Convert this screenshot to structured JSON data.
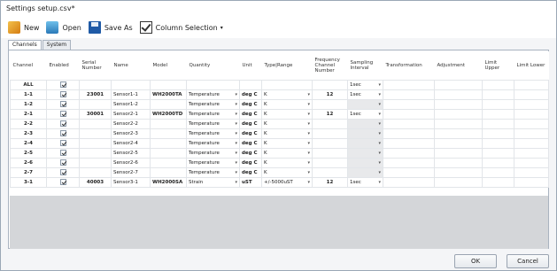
{
  "window": {
    "title": "Settings setup.csv*"
  },
  "toolbar": {
    "new_label": "New",
    "open_label": "Open",
    "save_as_label": "Save As",
    "column_selection_label": "Column Selection",
    "icons": [
      "new-icon",
      "open-icon",
      "save-icon",
      "checkbox-icon"
    ]
  },
  "tabs": [
    {
      "label": "Channels",
      "active": true
    },
    {
      "label": "System",
      "active": false
    }
  ],
  "table": {
    "headers": [
      "Channel",
      "Enabled",
      "Serial Number",
      "Name",
      "Model",
      "Quantity",
      "Unit",
      "Type|Range",
      "Frequency Channel Number",
      "Sampling Interval",
      "Transformation",
      "Adjustment",
      "Limit Upper",
      "Limit Lower"
    ],
    "rows": [
      {
        "channel": "ALL",
        "enabled": true,
        "serial": "",
        "name": "",
        "model": "",
        "quantity": "",
        "unit": "",
        "type": "",
        "freq": "",
        "sampling": "1sec",
        "quantity_dd": false,
        "type_dd": false,
        "sampling_dd": true
      },
      {
        "channel": "1-1",
        "enabled": true,
        "serial": "23001",
        "name": "Sensor1-1",
        "model": "WH2000TA",
        "quantity": "Temperature",
        "unit": "deg C",
        "type": "K",
        "freq": "12",
        "sampling": "1sec",
        "quantity_dd": true,
        "type_dd": true,
        "sampling_dd": true
      },
      {
        "channel": "1-2",
        "enabled": true,
        "serial": "",
        "name": "Sensor1-2",
        "model": "",
        "quantity": "Temperature",
        "unit": "deg C",
        "type": "K",
        "freq": "",
        "sampling": "",
        "quantity_dd": true,
        "type_dd": true,
        "sampling_dd": true
      },
      {
        "channel": "2-1",
        "enabled": true,
        "serial": "30001",
        "name": "Sensor2-1",
        "model": "WH2000TD",
        "quantity": "Temperature",
        "unit": "deg C",
        "type": "K",
        "freq": "12",
        "sampling": "1sec",
        "quantity_dd": true,
        "type_dd": true,
        "sampling_dd": true
      },
      {
        "channel": "2-2",
        "enabled": true,
        "serial": "",
        "name": "Sensor2-2",
        "model": "",
        "quantity": "Temperature",
        "unit": "deg C",
        "type": "K",
        "freq": "",
        "sampling": "",
        "quantity_dd": true,
        "type_dd": true,
        "sampling_dd": true
      },
      {
        "channel": "2-3",
        "enabled": true,
        "serial": "",
        "name": "Sensor2-3",
        "model": "",
        "quantity": "Temperature",
        "unit": "deg C",
        "type": "K",
        "freq": "",
        "sampling": "",
        "quantity_dd": true,
        "type_dd": true,
        "sampling_dd": true
      },
      {
        "channel": "2-4",
        "enabled": true,
        "serial": "",
        "name": "Sensor2-4",
        "model": "",
        "quantity": "Temperature",
        "unit": "deg C",
        "type": "K",
        "freq": "",
        "sampling": "",
        "quantity_dd": true,
        "type_dd": true,
        "sampling_dd": true
      },
      {
        "channel": "2-5",
        "enabled": true,
        "serial": "",
        "name": "Sensor2-5",
        "model": "",
        "quantity": "Temperature",
        "unit": "deg C",
        "type": "K",
        "freq": "",
        "sampling": "",
        "quantity_dd": true,
        "type_dd": true,
        "sampling_dd": true
      },
      {
        "channel": "2-6",
        "enabled": true,
        "serial": "",
        "name": "Sensor2-6",
        "model": "",
        "quantity": "Temperature",
        "unit": "deg C",
        "type": "K",
        "freq": "",
        "sampling": "",
        "quantity_dd": true,
        "type_dd": true,
        "sampling_dd": true
      },
      {
        "channel": "2-7",
        "enabled": true,
        "serial": "",
        "name": "Sensor2-7",
        "model": "",
        "quantity": "Temperature",
        "unit": "deg C",
        "type": "K",
        "freq": "",
        "sampling": "",
        "quantity_dd": true,
        "type_dd": true,
        "sampling_dd": true
      },
      {
        "channel": "3-1",
        "enabled": true,
        "serial": "40003",
        "name": "Sensor3-1",
        "model": "WH2000SA",
        "quantity": "Strain",
        "unit": "uST",
        "type": "+/-5000uST",
        "freq": "12",
        "sampling": "1sec",
        "quantity_dd": true,
        "type_dd": true,
        "sampling_dd": true
      }
    ]
  },
  "buttons": {
    "ok_label": "OK",
    "cancel_label": "Cancel"
  },
  "colors": {
    "frame_border": "#9aa7b6",
    "empty_area": "#d4d6d9",
    "readonly_cell": "#e8e9eb"
  }
}
